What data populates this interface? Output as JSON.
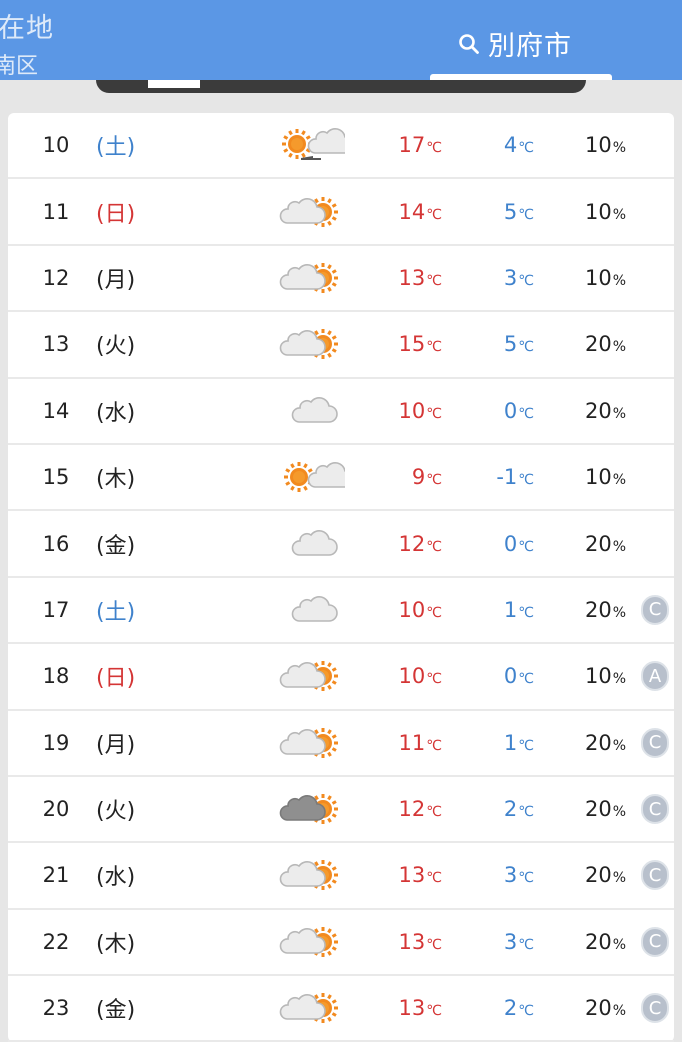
{
  "header": {
    "location_title": "在地",
    "location_sub": "南区",
    "tab_city": "別府市"
  },
  "units": {
    "temp": "℃",
    "percent": "%"
  },
  "days": [
    {
      "day": "10",
      "weekday": "(土)",
      "type": "sat",
      "weather": "sunny-then-cloudy",
      "high": "17",
      "low": "4",
      "pop": "10",
      "grade": ""
    },
    {
      "day": "11",
      "weekday": "(日)",
      "type": "sun",
      "weather": "cloudy-sometimes-sunny",
      "high": "14",
      "low": "5",
      "pop": "10",
      "grade": ""
    },
    {
      "day": "12",
      "weekday": "(月)",
      "type": "weekday",
      "weather": "cloudy-sometimes-sunny",
      "high": "13",
      "low": "3",
      "pop": "10",
      "grade": ""
    },
    {
      "day": "13",
      "weekday": "(火)",
      "type": "weekday",
      "weather": "cloudy-sometimes-sunny",
      "high": "15",
      "low": "5",
      "pop": "20",
      "grade": ""
    },
    {
      "day": "14",
      "weekday": "(水)",
      "type": "weekday",
      "weather": "cloudy",
      "high": "10",
      "low": "0",
      "pop": "20",
      "grade": ""
    },
    {
      "day": "15",
      "weekday": "(木)",
      "type": "weekday",
      "weather": "sunny-sometimes-cloudy",
      "high": "9",
      "low": "-1",
      "pop": "10",
      "grade": ""
    },
    {
      "day": "16",
      "weekday": "(金)",
      "type": "weekday",
      "weather": "cloudy",
      "high": "12",
      "low": "0",
      "pop": "20",
      "grade": ""
    },
    {
      "day": "17",
      "weekday": "(土)",
      "type": "sat",
      "weather": "cloudy",
      "high": "10",
      "low": "1",
      "pop": "20",
      "grade": "C"
    },
    {
      "day": "18",
      "weekday": "(日)",
      "type": "sun",
      "weather": "cloudy-sometimes-sunny",
      "high": "10",
      "low": "0",
      "pop": "10",
      "grade": "A"
    },
    {
      "day": "19",
      "weekday": "(月)",
      "type": "weekday",
      "weather": "cloudy-sometimes-sunny",
      "high": "11",
      "low": "1",
      "pop": "20",
      "grade": "C"
    },
    {
      "day": "20",
      "weekday": "(火)",
      "type": "weekday",
      "weather": "dark-cloudy-sometimes-sunny",
      "high": "12",
      "low": "2",
      "pop": "20",
      "grade": "C"
    },
    {
      "day": "21",
      "weekday": "(水)",
      "type": "weekday",
      "weather": "cloudy-sometimes-sunny",
      "high": "13",
      "low": "3",
      "pop": "20",
      "grade": "C"
    },
    {
      "day": "22",
      "weekday": "(木)",
      "type": "weekday",
      "weather": "cloudy-sometimes-sunny",
      "high": "13",
      "low": "3",
      "pop": "20",
      "grade": "C"
    },
    {
      "day": "23",
      "weekday": "(金)",
      "type": "weekday",
      "weather": "cloudy-sometimes-sunny",
      "high": "13",
      "low": "2",
      "pop": "20",
      "grade": "C"
    }
  ],
  "colors": {
    "header_bg": "#5b97e5",
    "high_temp": "#d43535",
    "low_temp": "#3f82cc",
    "sun": "#f28a1f",
    "cloud": "#e8e8e8",
    "grade_badge": "#b8c0cc"
  }
}
